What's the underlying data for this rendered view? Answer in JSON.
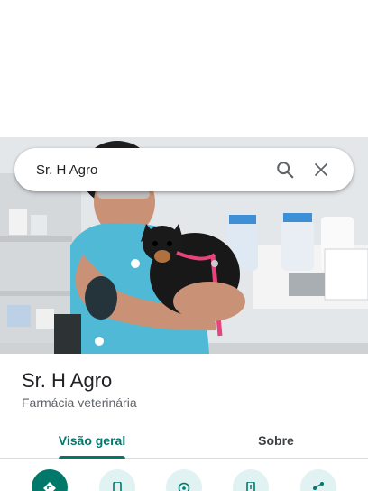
{
  "search": {
    "query": "Sr. H Agro"
  },
  "icons": {
    "search": "search-icon",
    "close": "close-icon"
  },
  "place": {
    "name": "Sr. H Agro",
    "category": "Farmácia veterinária"
  },
  "tabs": [
    {
      "label": "Visão geral",
      "active": true
    },
    {
      "label": "Sobre",
      "active": false
    }
  ],
  "actions": [
    {
      "icon": "directions-icon"
    },
    {
      "icon": "call-icon"
    },
    {
      "icon": "nearby-icon"
    },
    {
      "icon": "send-to-phone-icon"
    },
    {
      "icon": "share-icon"
    }
  ],
  "colors": {
    "accent": "#00796b",
    "action_bg": "#e0f2f1",
    "text": "#202124",
    "muted": "#5f6368"
  }
}
